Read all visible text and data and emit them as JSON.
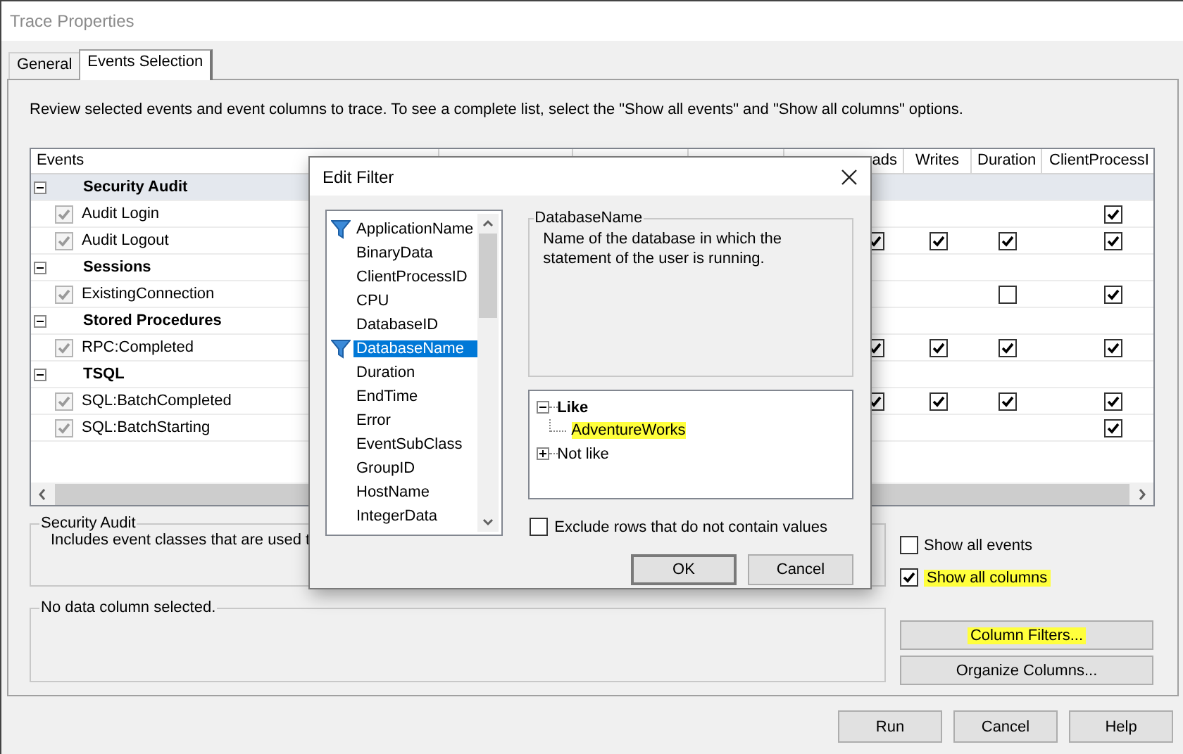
{
  "window": {
    "title": "Trace Properties"
  },
  "tabs": [
    {
      "label": "General",
      "selected": false
    },
    {
      "label": "Events Selection",
      "selected": true
    }
  ],
  "instructions": "Review selected events and event columns to trace. To see a complete list, select the \"Show all events\" and \"Show all columns\" options.",
  "grid": {
    "events_column": "Events",
    "visible_columns": [
      "ads",
      "Writes",
      "Duration",
      "ClientProcessI"
    ],
    "rows": [
      {
        "kind": "category",
        "label": "Security Audit",
        "expanded": true,
        "selected": true
      },
      {
        "kind": "event",
        "label": "Audit Login",
        "checked": true,
        "cells": [
          null,
          null,
          null,
          true
        ]
      },
      {
        "kind": "event",
        "label": "Audit Logout",
        "checked": true,
        "cells": [
          true,
          true,
          true,
          true
        ]
      },
      {
        "kind": "category",
        "label": "Sessions",
        "expanded": true,
        "selected": false
      },
      {
        "kind": "event",
        "label": "ExistingConnection",
        "checked": true,
        "cells": [
          null,
          null,
          false,
          true
        ]
      },
      {
        "kind": "category",
        "label": "Stored Procedures",
        "expanded": true,
        "selected": false
      },
      {
        "kind": "event",
        "label": "RPC:Completed",
        "checked": true,
        "cells": [
          true,
          true,
          true,
          true
        ]
      },
      {
        "kind": "category",
        "label": "TSQL",
        "expanded": true,
        "selected": false
      },
      {
        "kind": "event",
        "label": "SQL:BatchCompleted",
        "checked": true,
        "cells": [
          true,
          true,
          true,
          true
        ]
      },
      {
        "kind": "event",
        "label": "SQL:BatchStarting",
        "checked": true,
        "cells": [
          null,
          null,
          null,
          true
        ]
      }
    ]
  },
  "event_description": {
    "title": "Security Audit",
    "text": "Includes event classes that are used t"
  },
  "column_description": {
    "title": "No data column selected."
  },
  "options": [
    {
      "label": "Show all events",
      "checked": false,
      "highlighted": false
    },
    {
      "label": "Show all columns",
      "checked": true,
      "highlighted": true
    }
  ],
  "side_buttons": [
    {
      "label": "Column Filters...",
      "highlighted": true
    },
    {
      "label": "Organize Columns...",
      "highlighted": false
    }
  ],
  "footer_buttons": [
    "Run",
    "Cancel",
    "Help"
  ],
  "dialog": {
    "title": "Edit Filter",
    "columns": [
      {
        "label": "ApplicationName",
        "filtered": true,
        "selected": false
      },
      {
        "label": "BinaryData",
        "filtered": false,
        "selected": false
      },
      {
        "label": "ClientProcessID",
        "filtered": false,
        "selected": false
      },
      {
        "label": "CPU",
        "filtered": false,
        "selected": false
      },
      {
        "label": "DatabaseID",
        "filtered": false,
        "selected": false
      },
      {
        "label": "DatabaseName",
        "filtered": true,
        "selected": true
      },
      {
        "label": "Duration",
        "filtered": false,
        "selected": false
      },
      {
        "label": "EndTime",
        "filtered": false,
        "selected": false
      },
      {
        "label": "Error",
        "filtered": false,
        "selected": false
      },
      {
        "label": "EventSubClass",
        "filtered": false,
        "selected": false
      },
      {
        "label": "GroupID",
        "filtered": false,
        "selected": false
      },
      {
        "label": "HostName",
        "filtered": false,
        "selected": false
      },
      {
        "label": "IntegerData",
        "filtered": false,
        "selected": false
      }
    ],
    "info": {
      "title": "DatabaseName",
      "text": "Name of the database in which the statement of the user is running."
    },
    "tree": [
      {
        "label": "Like",
        "expanded": true,
        "children": [
          {
            "label": "AdventureWorks",
            "highlighted": true
          }
        ]
      },
      {
        "label": "Not like",
        "expanded": false
      }
    ],
    "exclude": {
      "label": "Exclude rows that do not contain values",
      "checked": false
    },
    "buttons": [
      {
        "label": "OK",
        "default": true
      },
      {
        "label": "Cancel",
        "default": false
      }
    ]
  }
}
